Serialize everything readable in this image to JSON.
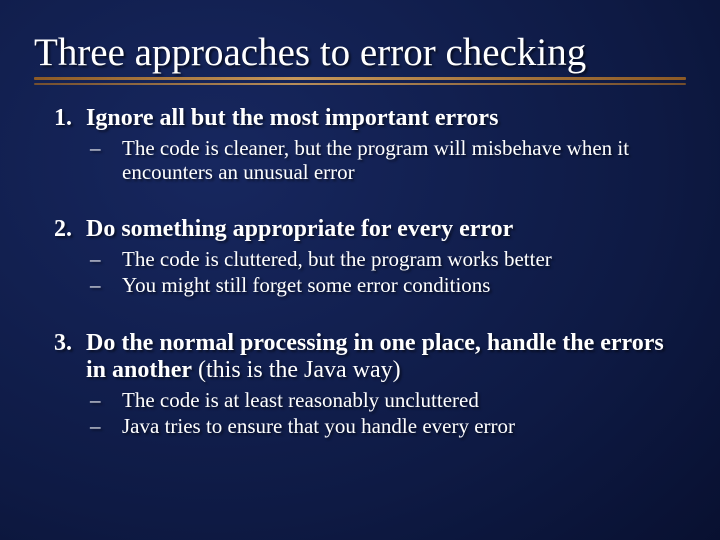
{
  "title": "Three approaches to error checking",
  "items": [
    {
      "heading": "Ignore all but the most important errors",
      "paren": "",
      "subs": [
        "The code is cleaner, but the program will misbehave when it encounters an unusual error"
      ]
    },
    {
      "heading": "Do something appropriate for every error",
      "paren": "",
      "subs": [
        "The code is cluttered, but the program works better",
        "You might still forget some error conditions"
      ]
    },
    {
      "heading": "Do the normal processing in one place, handle the errors in another",
      "paren": " (this is the Java way)",
      "subs": [
        "The code is at least reasonably uncluttered",
        "Java tries to ensure that you handle every error"
      ]
    }
  ]
}
